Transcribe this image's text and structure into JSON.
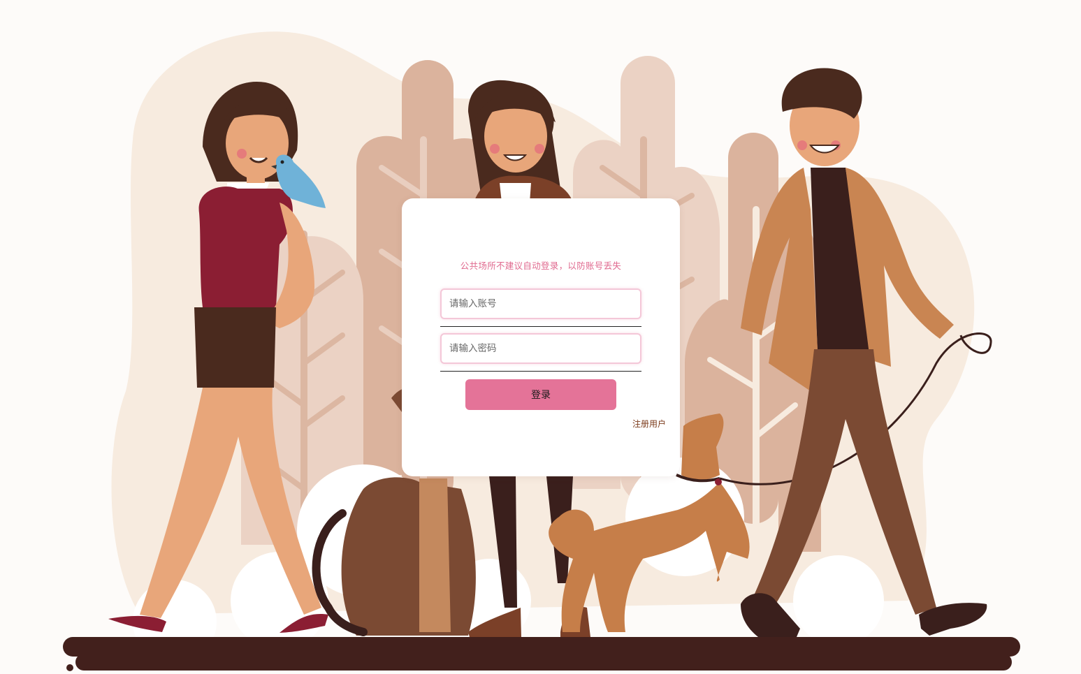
{
  "login": {
    "notice": "公共场所不建议自动登录，以防账号丢失",
    "username_placeholder": "请输入账号",
    "username_value": "",
    "password_placeholder": "请输入密码",
    "password_value": "",
    "login_button": "登录",
    "register_link": "注册用户"
  },
  "colors": {
    "accent": "#e47398",
    "notice_text": "#e06a8f",
    "link_text": "#7b3a1a",
    "ground": "#42201c"
  },
  "illustration": {
    "icons": [
      "woman-with-bird-icon",
      "woman-in-jacket-icon",
      "man-with-dog-icon",
      "sitting-dog-icon",
      "walking-dog-icon",
      "tree-icon",
      "bird-icon"
    ]
  }
}
